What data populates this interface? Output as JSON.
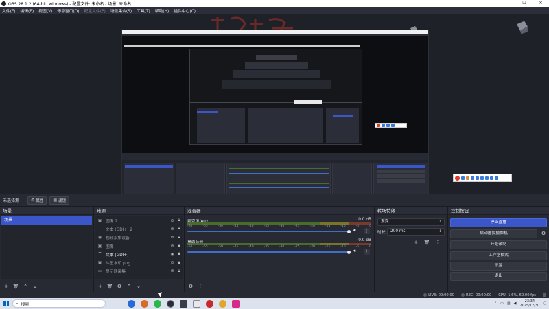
{
  "window": {
    "title": "OBS 28.1.2 (64-bit, windows) - 配置文件: 未命名 - 场景: 未命名",
    "minimize": "—",
    "maximize": "☐",
    "close": "✕"
  },
  "menu": {
    "items": [
      "文件(F)",
      "编辑(E)",
      "视图(V)",
      "停靠窗口(D)",
      "配置文件(P)",
      "场景集合(S)",
      "工具(T)",
      "帮助(H)",
      "插件中心(C)"
    ]
  },
  "source_toolbar": {
    "label": "未选择源",
    "properties": "属性",
    "filters": "滤镜"
  },
  "scenes": {
    "title": "场景",
    "items": [
      "场景"
    ]
  },
  "sources": {
    "title": "来源",
    "items": [
      {
        "name": "图像 2",
        "icon": "image-icon",
        "visible": false
      },
      {
        "name": "文本 (GDI+) 2",
        "icon": "text-icon",
        "visible": false
      },
      {
        "name": "视频采集设备",
        "icon": "camera-icon",
        "visible": false
      },
      {
        "name": "图像",
        "icon": "image-icon",
        "visible": false
      },
      {
        "name": "文本 (GDI+)",
        "icon": "text-icon",
        "visible": true
      },
      {
        "name": "斗鱼水印.png",
        "icon": "image-icon",
        "visible": false
      },
      {
        "name": "显示器采集",
        "icon": "monitor-icon",
        "visible": false
      }
    ]
  },
  "mixer": {
    "title": "混音器",
    "ticks": [
      "-60",
      "-55",
      "-50",
      "-45",
      "-40",
      "-35",
      "-30",
      "-25",
      "-20",
      "-15",
      "-10",
      "-5",
      "0"
    ],
    "channels": [
      {
        "name": "麦克风/Aux",
        "db": "0.0 dB",
        "level": 1.0
      },
      {
        "name": "桌面音频",
        "db": "0.0 dB",
        "level": 1.0
      }
    ]
  },
  "transitions": {
    "title": "转场特效",
    "selected": "渐变",
    "duration_label": "时长",
    "duration": "200 ms"
  },
  "controls": {
    "title": "控制按钮",
    "buttons": [
      "停止直播",
      "启动虚拟摄像机",
      "开始录制",
      "工作室模式",
      "设置",
      "退出"
    ]
  },
  "statusbar": {
    "live": "LIVE: 00:00:00",
    "rec": "REC: 00:00:00",
    "cpu": "CPU: 1.6%, 60.00 fps"
  },
  "taskbar": {
    "search_placeholder": "搜索",
    "time": "23:34",
    "date": "2025/12/30"
  },
  "colors": {
    "accent": "#3a56c9",
    "panel": "#272a33",
    "background": "#1f2128"
  }
}
